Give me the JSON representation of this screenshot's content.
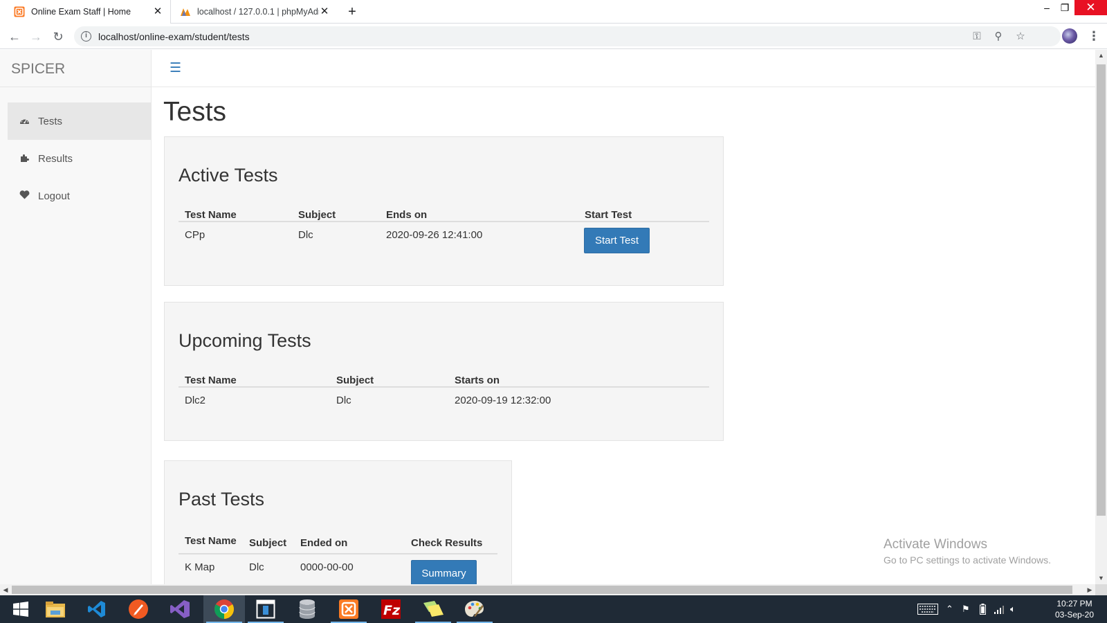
{
  "browser": {
    "tabs": [
      {
        "title": "Online Exam Staff | Home",
        "active": true
      },
      {
        "title": "localhost / 127.0.0.1 | phpMyAdmin",
        "active": false
      }
    ],
    "url": "localhost/online-exam/student/tests"
  },
  "sidebar": {
    "brand": "SPICER",
    "items": [
      {
        "label": "Tests",
        "icon": "dashboard-icon",
        "active": true
      },
      {
        "label": "Results",
        "icon": "puzzle-icon",
        "active": false
      },
      {
        "label": "Logout",
        "icon": "heart-icon",
        "active": false
      }
    ]
  },
  "page": {
    "title": "Tests"
  },
  "active_tests": {
    "heading": "Active Tests",
    "columns": [
      "Test Name",
      "Subject",
      "Ends on",
      "Start Test"
    ],
    "rows": [
      {
        "name": "CPp",
        "subject": "Dlc",
        "date": "2020-09-26 12:41:00",
        "action": "Start Test"
      }
    ]
  },
  "upcoming_tests": {
    "heading": "Upcoming Tests",
    "columns": [
      "Test Name",
      "Subject",
      "Starts on"
    ],
    "rows": [
      {
        "name": "Dlc2",
        "subject": "Dlc",
        "date": "2020-09-19 12:32:00"
      }
    ]
  },
  "past_tests": {
    "heading": "Past Tests",
    "columns": [
      "Test Name",
      "Subject",
      "Ended on",
      "Check Results"
    ],
    "rows": [
      {
        "name": "K Map",
        "subject": "Dlc",
        "date": "0000-00-00",
        "action": "Summary"
      }
    ]
  },
  "watermark": {
    "line1": "Activate Windows",
    "line2": "Go to PC settings to activate Windows."
  },
  "taskbar": {
    "time": "10:27 PM",
    "date": "03-Sep-20"
  },
  "colors": {
    "primary": "#337ab7",
    "sidebar_bg": "#f8f8f8",
    "card_bg": "#f5f5f5",
    "taskbar_bg": "#1f2a36"
  }
}
